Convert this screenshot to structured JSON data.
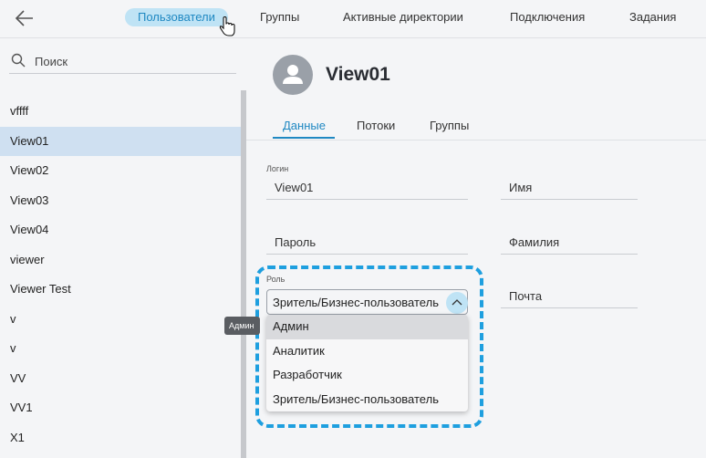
{
  "topnav": {
    "tabs": [
      {
        "label": "Пользователи",
        "active": true
      },
      {
        "label": "Группы"
      },
      {
        "label": "Активные директории"
      },
      {
        "label": "Подключения"
      },
      {
        "label": "Задания"
      }
    ]
  },
  "sidebar": {
    "search": {
      "placeholder": "Поиск",
      "value": ""
    },
    "users": [
      "vffff",
      "View01",
      "View02",
      "View03",
      "View04",
      "viewer",
      "Viewer Test",
      "v",
      "v",
      "VV",
      "VV1",
      "X1"
    ],
    "selected_index": 1
  },
  "main": {
    "user_name": "View01",
    "tabs": [
      {
        "label": "Данные",
        "active": true
      },
      {
        "label": "Потоки"
      },
      {
        "label": "Группы"
      }
    ],
    "fields": {
      "login_label": "Логин",
      "login_value": "View01",
      "password_placeholder": "Пароль",
      "first_name_placeholder": "Имя",
      "last_name_placeholder": "Фамилия",
      "email_placeholder": "Почта",
      "role_label": "Роль",
      "role_value": "Зритель/Бизнес-пользователь"
    },
    "role_options": [
      "Админ",
      "Аналитик",
      "Разработчик",
      "Зритель/Бизнес-пользователь"
    ],
    "tooltip": "Админ"
  },
  "colors": {
    "accent": "#1f88c2",
    "active_tab_bg": "#bfe3f5",
    "selected_row_bg": "#cfe0f1",
    "highlight_dash": "#1e9fdf"
  }
}
